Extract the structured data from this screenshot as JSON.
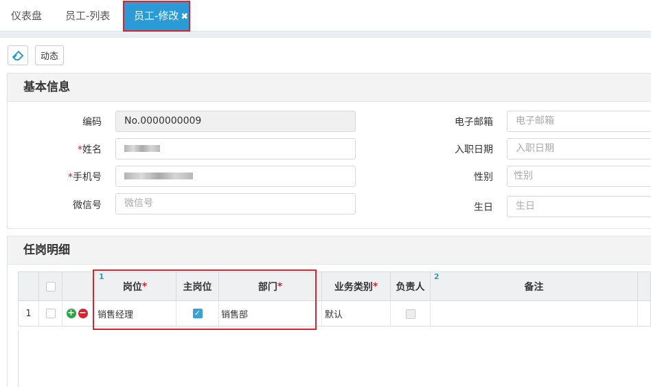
{
  "tabs": [
    {
      "label": "仪表盘"
    },
    {
      "label": "员工-列表"
    },
    {
      "label": "员工-修改",
      "close": "✖"
    }
  ],
  "toolbar": {
    "eraser_icon": "eraser-icon",
    "activity_label": "动态"
  },
  "basic_info": {
    "title": "基本信息",
    "fields": {
      "code": {
        "label": "编码",
        "value": "No.0000000009"
      },
      "name": {
        "label": "姓名",
        "required": "*"
      },
      "phone": {
        "label": "手机号",
        "required": "*"
      },
      "wechat": {
        "label": "微信号",
        "placeholder": "微信号"
      },
      "email": {
        "label": "电子邮箱",
        "placeholder": "电子邮箱"
      },
      "hire_date": {
        "label": "入职日期",
        "placeholder": "入职日期"
      },
      "gender": {
        "label": "性别",
        "placeholder": "性别"
      },
      "birthday": {
        "label": "生日",
        "placeholder": "生日"
      }
    }
  },
  "positions": {
    "title": "任岗明细",
    "sort_icon_1": "1",
    "sort_icon_2": "2",
    "columns": {
      "position": "岗位",
      "primary": "主岗位",
      "department": "部门",
      "business_type": "业务类别",
      "manager": "负责人",
      "remark": "备注",
      "required": "*"
    },
    "rows": [
      {
        "index": "1",
        "position": "销售经理",
        "primary_checked": true,
        "department": "销售部",
        "business_type": "默认",
        "manager_checked": false,
        "remark": ""
      }
    ]
  }
}
